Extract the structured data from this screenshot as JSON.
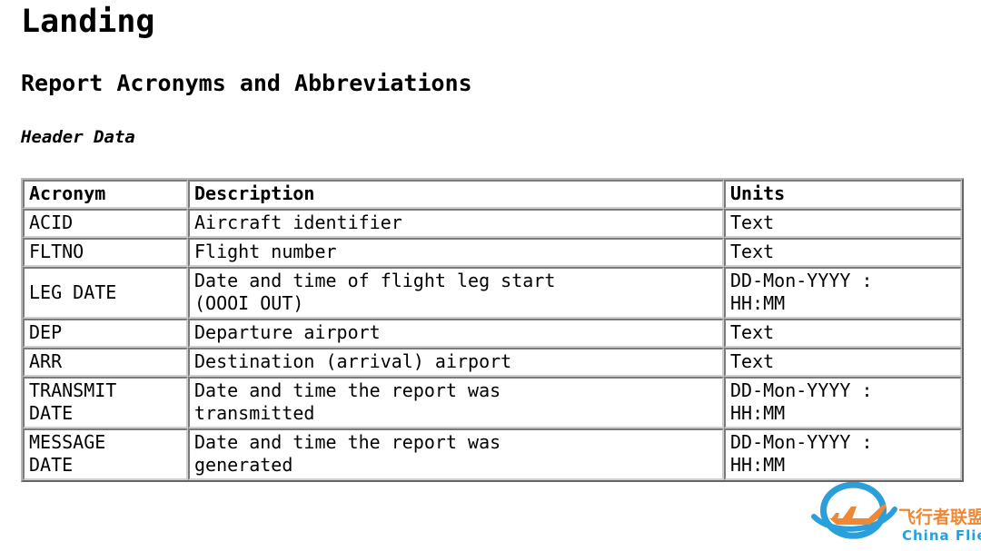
{
  "document": {
    "title": "Landing",
    "subtitle": "Report Acronyms and Abbreviations",
    "section_heading": "Header Data"
  },
  "table": {
    "name": "header-data-acronyms",
    "columns": [
      "Acronym",
      "Description",
      "Units"
    ],
    "rows": [
      {
        "acronym": "ACID",
        "description_line1": "Aircraft identifier",
        "description_line2": "",
        "units_line1": "Text",
        "units_line2": ""
      },
      {
        "acronym": "FLTNO",
        "description_line1": "Flight number",
        "description_line2": "",
        "units_line1": "Text",
        "units_line2": ""
      },
      {
        "acronym": "LEG DATE",
        "description_line1": "Date and time of flight leg start",
        "description_line2": "(OOOI OUT)",
        "units_line1": "DD-Mon-YYYY :",
        "units_line2": "HH:MM"
      },
      {
        "acronym": "DEP",
        "description_line1": "Departure airport",
        "description_line2": "",
        "units_line1": "Text",
        "units_line2": ""
      },
      {
        "acronym": "ARR",
        "description_line1": "Destination (arrival) airport",
        "description_line2": "",
        "units_line1": "Text",
        "units_line2": ""
      },
      {
        "acronym_line1": "TRANSMIT",
        "acronym_line2": "DATE",
        "acronym": "TRANSMIT DATE",
        "description_line1": "Date and time the report was",
        "description_line2": "transmitted",
        "units_line1": "DD-Mon-YYYY :",
        "units_line2": "HH:MM"
      },
      {
        "acronym_line1": "MESSAGE",
        "acronym_line2": "DATE",
        "acronym": "MESSAGE DATE",
        "description_line1": "Date and time the report was",
        "description_line2": "generated",
        "units_line1": "DD-Mon-YYYY :",
        "units_line2": "HH:MM"
      }
    ]
  },
  "watermark": {
    "text_cn": "飞行者联盟",
    "text_en": "China Flier",
    "color_blue": "#2b9fd9",
    "color_orange": "#ef8734"
  },
  "colors": {
    "page_background": "#ffffff",
    "text": "#000000",
    "table_border_outer": "#b9b9b9",
    "table_border_inner": "#cfcfcf"
  }
}
